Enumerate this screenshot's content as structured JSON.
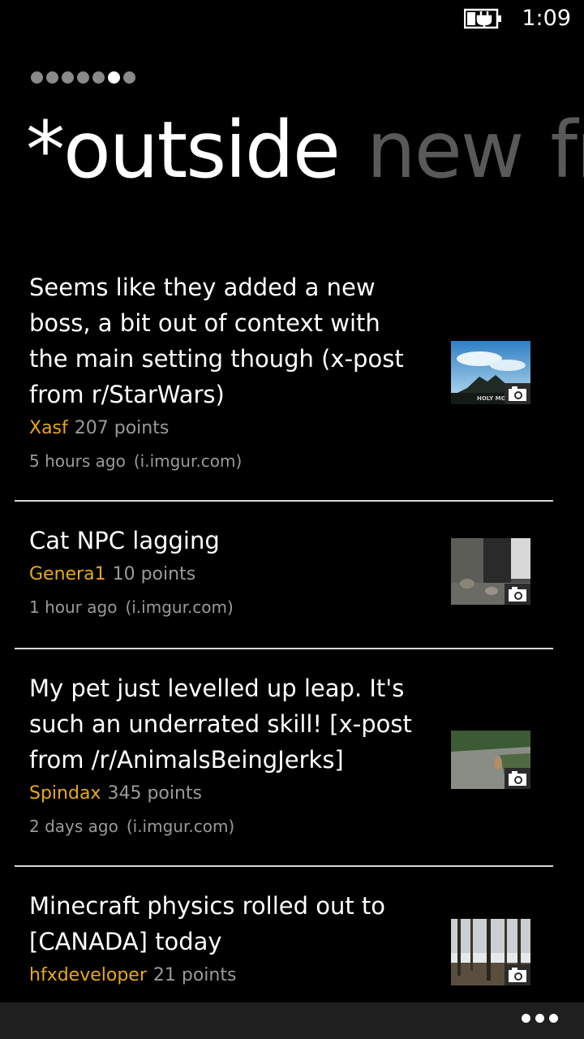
{
  "status_bar": {
    "time": "1:09",
    "battery_icon": "battery-charging-icon"
  },
  "pivot": {
    "dot_count": 7,
    "active_index": 5,
    "active_header": "*outside",
    "next_header": "new",
    "next_next_header": "fr"
  },
  "posts": [
    {
      "title": "Seems like they added a new boss, a bit out of context with the main setting though (x-post from r/StarWars)",
      "author": "Xasf",
      "points": "207 points",
      "age": "5 hours ago",
      "domain": "(i.imgur.com)",
      "thumbnail_icon": "camera-icon"
    },
    {
      "title": "Cat NPC lagging",
      "author": "Genera1",
      "points": "10 points",
      "age": "1 hour ago",
      "domain": "(i.imgur.com)",
      "thumbnail_icon": "camera-icon"
    },
    {
      "title": "My pet just levelled up leap. It's such an underrated skill! [x-post from /r/AnimalsBeingJerks]",
      "author": "Spindax",
      "points": "345 points",
      "age": "2 days ago",
      "domain": "(i.imgur.com)",
      "thumbnail_icon": "camera-icon"
    },
    {
      "title": "Minecraft physics rolled out to [CANADA] today",
      "author": "hfxdeveloper",
      "points": "21 points",
      "age": "",
      "domain": "",
      "thumbnail_icon": "camera-icon"
    }
  ],
  "thumbnail_texts": {
    "post_0_caption": "HOLY MOTHER OF"
  },
  "app_bar": {
    "more_icon": "ellipsis-icon"
  },
  "colors": {
    "accent_author": "#e8a81c",
    "secondary_text": "#9a9a9a",
    "divider": "#d9d9d9",
    "app_bar_bg": "#1f1f1f"
  }
}
